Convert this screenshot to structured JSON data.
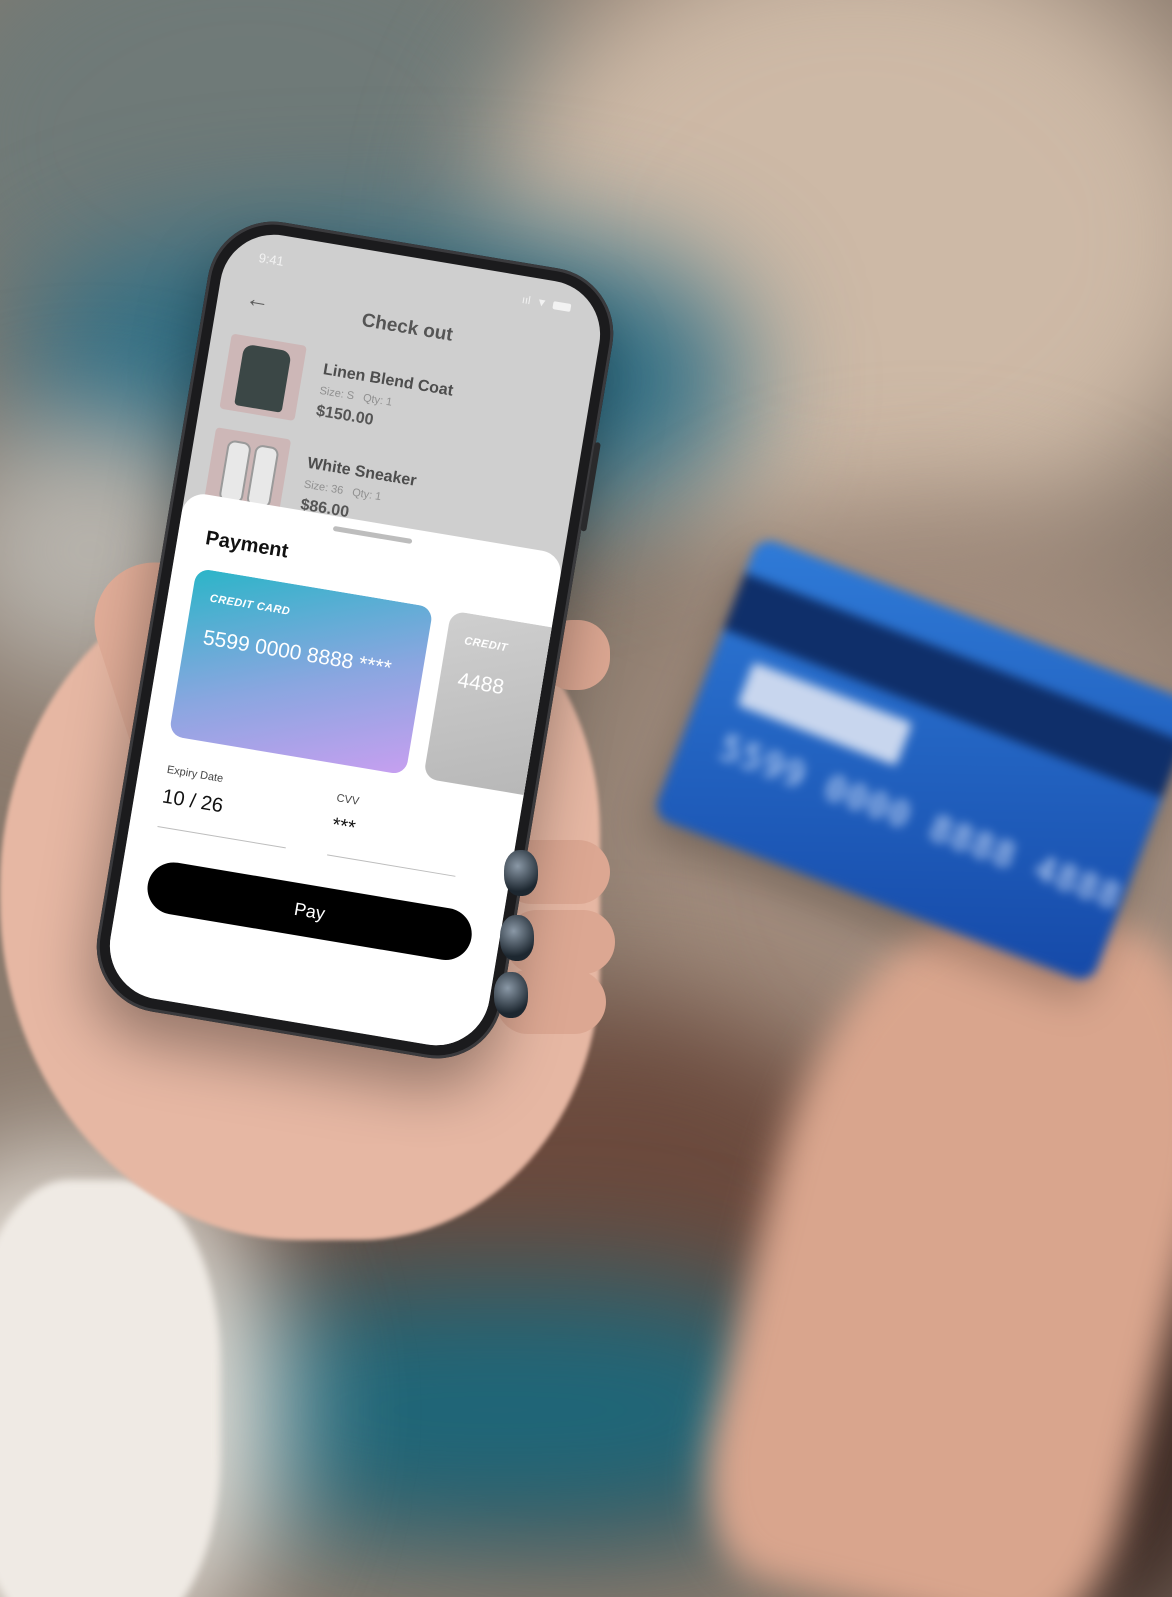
{
  "status_bar": {
    "time": "9:41",
    "signal": "ııl"
  },
  "checkout": {
    "title": "Check out",
    "items": [
      {
        "name": "Linen Blend Coat",
        "size": "Size: S",
        "qty": "Qty: 1",
        "price": "$150.00"
      },
      {
        "name": "White Sneaker",
        "size": "Size: 36",
        "qty": "Qty: 1",
        "price": "$86.00"
      }
    ]
  },
  "payment": {
    "title": "Payment",
    "cards": [
      {
        "label": "CREDIT CARD",
        "number": "5599 0000 8888 ****",
        "colors": [
          "#2bb5c8",
          "#c79ff0"
        ]
      },
      {
        "label": "CREDIT",
        "number": "4488"
      }
    ],
    "expiry": {
      "label": "Expiry Date",
      "value": "10 / 26"
    },
    "cvv": {
      "label": "CVV",
      "value": "***"
    },
    "pay_label": "Pay"
  },
  "physical_card": {
    "digits": "5599 0000 8888 4888"
  }
}
